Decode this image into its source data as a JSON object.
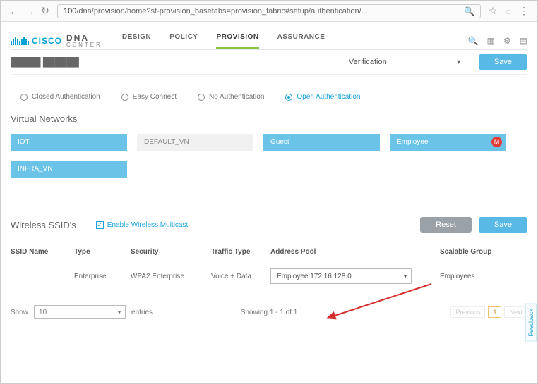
{
  "browser": {
    "url_pre": "100",
    "url_tail": "/dna/provision/home?st-provision_basetabs=provision_fabric#setup/authentication/..."
  },
  "logo": {
    "brand": "CISCO",
    "product": "DNA",
    "sub": "CENTER"
  },
  "nav": {
    "items": [
      "DESIGN",
      "POLICY",
      "PROVISION",
      "ASSURANCE"
    ],
    "active": 2
  },
  "section": {
    "verification_label": "Verification",
    "save_label": "Save"
  },
  "auth": {
    "options": [
      "Closed Authentication",
      "Easy Connect",
      "No Authentication",
      "Open Authentication"
    ],
    "selected": 3
  },
  "vn": {
    "title": "Virtual Networks",
    "items": [
      {
        "label": "IOT",
        "style": "blue"
      },
      {
        "label": "DEFAULT_VN",
        "style": "plain"
      },
      {
        "label": "Guest",
        "style": "blue"
      },
      {
        "label": "Employee",
        "style": "blue",
        "badge": "M"
      },
      {
        "label": "INFRA_VN",
        "style": "blue"
      }
    ]
  },
  "ssid": {
    "title": "Wireless SSID's",
    "multicast_label": "Enable Wireless Multicast",
    "reset_label": "Reset",
    "save_label": "Save",
    "cols": {
      "name": "SSID Name",
      "type": "Type",
      "security": "Security",
      "traffic": "Traffic Type",
      "pool": "Address Pool",
      "group": "Scalable Group"
    },
    "rows": [
      {
        "name": "",
        "type": "Enterprise",
        "security": "WPA2 Enterprise",
        "traffic": "Voice + Data",
        "pool": "Employee:172.16.128.0",
        "group": "Employees"
      }
    ]
  },
  "footer": {
    "show_label": "Show",
    "show_value": "10",
    "entries_label": "entries",
    "showing": "Showing 1 - 1 of 1",
    "prev": "Previous",
    "page": "1",
    "next": "Next"
  },
  "feedback_label": "Feedback"
}
